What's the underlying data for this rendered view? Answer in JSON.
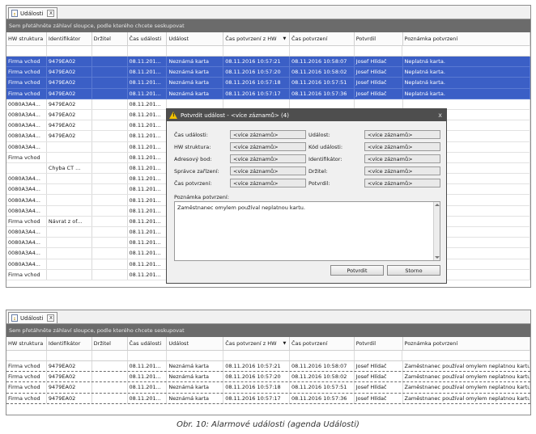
{
  "tab_label": "Události",
  "tab_close": "x",
  "group_hint": "Sem přetáhněte záhlaví sloupce, podle kterého chcete seskupovat",
  "columns": [
    "HW struktura",
    "Identifikátor",
    "Držitel",
    "Čas události",
    "Událost",
    "Čas potvrzení z HW",
    "Čas potvrzení",
    "Potvrdil",
    "Poznámka potvrzení"
  ],
  "sort_icon": "▼",
  "top_rows": [
    [
      "Firma vchod",
      "9479EA02",
      "",
      "08.11.201...",
      "Neznámá karta",
      "08.11.2016 10:57:21",
      "08.11.2016 10:58:07",
      "Josef Hlídač",
      "Neplatná karta."
    ],
    [
      "Firma vchod",
      "9479EA02",
      "",
      "08.11.201...",
      "Neznámá karta",
      "08.11.2016 10:57:20",
      "08.11.2016 10:58:02",
      "Josef Hlídač",
      "Neplatná karta."
    ],
    [
      "Firma vchod",
      "9479EA02",
      "",
      "08.11.201...",
      "Neznámá karta",
      "08.11.2016 10:57:18",
      "08.11.2016 10:57:51",
      "Josef Hlídač",
      "Neplatná karta."
    ],
    [
      "Firma vchod",
      "9479EA02",
      "",
      "08.11.201...",
      "Neznámá karta",
      "08.11.2016 10:57:17",
      "08.11.2016 10:57:36",
      "Josef Hlídač",
      "Neplatná karta."
    ],
    [
      "0080A3A4...",
      "9479EA02",
      "",
      "08.11.201..."
    ],
    [
      "0080A3A4...",
      "9479EA02",
      "",
      "08.11.201..."
    ],
    [
      "0080A3A4...",
      "9479EA02",
      "",
      "08.11.201..."
    ],
    [
      "0080A3A4...",
      "9479EA02",
      "",
      "08.11.201..."
    ],
    [
      "0080A3A4...",
      "",
      "",
      "08.11.201..."
    ],
    [
      "Firma vchod",
      "",
      "",
      "08.11.201..."
    ],
    [
      "",
      "Chyba CT ...",
      "",
      "08.11.201..."
    ],
    [
      "0080A3A4...",
      "",
      "",
      "08.11.201..."
    ],
    [
      "0080A3A4...",
      "",
      "",
      "08.11.201..."
    ],
    [
      "0080A3A4...",
      "",
      "",
      "08.11.201..."
    ],
    [
      "0080A3A4...",
      "",
      "",
      "08.11.201..."
    ],
    [
      "Firma vchod",
      "Návrat z of...",
      "",
      "08.11.201..."
    ],
    [
      "0080A3A4...",
      "",
      "",
      "08.11.201..."
    ],
    [
      "0080A3A4...",
      "",
      "",
      "08.11.201..."
    ],
    [
      "0080A3A4...",
      "",
      "",
      "08.11.201..."
    ],
    [
      "0080A3A4...",
      "",
      "",
      "08.11.201..."
    ],
    [
      "Firma vchod",
      "",
      "",
      "08.11.201..."
    ]
  ],
  "dialog": {
    "title": "Potvrdit událost - <více záznamů> (4)",
    "close": "x",
    "fields": [
      {
        "label": "Čas události:",
        "value": "<více záznamů>"
      },
      {
        "label": "Událost:",
        "value": "<více záznamů>"
      },
      {
        "label": "HW struktura:",
        "value": "<více záznamů>"
      },
      {
        "label": "Kód události:",
        "value": "<více záznamů>"
      },
      {
        "label": "Adresový bod:",
        "value": "<více záznamů>"
      },
      {
        "label": "Identifikátor:",
        "value": "<více záznamů>"
      },
      {
        "label": "Správce zařízení:",
        "value": "<více záznamů>"
      },
      {
        "label": "Držitel:",
        "value": "<více záznamů>"
      },
      {
        "label": "Čas potvrzení:",
        "value": "<více záznamů>"
      },
      {
        "label": "Potvrdil:",
        "value": "<více záznamů>"
      }
    ],
    "note_label": "Poznámka potvrzení:",
    "note_value": "Zaměstnanec omylem používal neplatnou kartu.",
    "confirm_label": "Potvrdit",
    "cancel_label": "Storno"
  },
  "bottom_rows": [
    [
      "Firma vchod",
      "9479EA02",
      "",
      "08.11.201...",
      "Neznámá karta",
      "08.11.2016 10:57:21",
      "08.11.2016 10:58:07",
      "Josef Hlídač",
      "Zaměstnanec používal omylem neplatnou kartu."
    ],
    [
      "Firma vchod",
      "9479EA02",
      "",
      "08.11.201...",
      "Neznámá karta",
      "08.11.2016 10:57:20",
      "08.11.2016 10:58:02",
      "Josef Hlídač",
      "Zaměstnanec používal omylem neplatnou kartu."
    ],
    [
      "Firma vchod",
      "9479EA02",
      "",
      "08.11.201...",
      "Neznámá karta",
      "08.11.2016 10:57:18",
      "08.11.2016 10:57:51",
      "Josef Hlídač",
      "Zaměstnanec používal omylem neplatnou kartu."
    ],
    [
      "Firma vchod",
      "9479EA02",
      "",
      "08.11.201...",
      "Neznámá karta",
      "08.11.2016 10:57:17",
      "08.11.2016 10:57:36",
      "Josef Hlídač",
      "Zaměstnanec používal omylem neplatnou kartu."
    ]
  ],
  "caption": "Obr.  10: Alarmové události (agenda Události)"
}
